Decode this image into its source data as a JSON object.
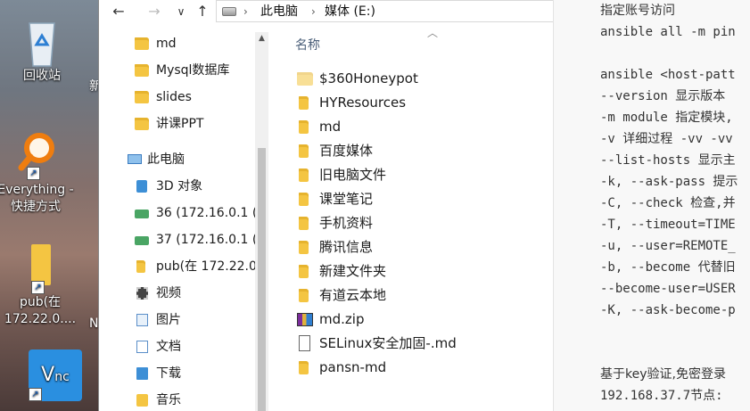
{
  "desktop": {
    "icons": [
      {
        "label": "回收站",
        "icon": "recycle-bin-icon"
      },
      {
        "label": "Everything -\n快捷方式",
        "icon": "everything-magnifier-icon"
      },
      {
        "label": "pub(在\n172.22.0....",
        "icon": "folder-shortcut-icon"
      },
      {
        "label": "",
        "icon": "vnc-icon"
      }
    ],
    "clipped_labels": [
      "新",
      "N"
    ]
  },
  "explorer": {
    "nav_back": "←",
    "nav_forward": "→",
    "nav_recent": "∨",
    "nav_up": "↑",
    "breadcrumb": [
      "此电脑",
      "媒体 (E:)"
    ],
    "nav_items": [
      {
        "label": "md",
        "icon": "folder-icon"
      },
      {
        "label": "Mysql数据库",
        "icon": "folder-icon"
      },
      {
        "label": "slides",
        "icon": "folder-icon"
      },
      {
        "label": "讲课PPT",
        "icon": "folder-icon"
      },
      {
        "label": "此电脑",
        "icon": "this-pc-icon"
      },
      {
        "label": "3D 对象",
        "icon": "3d-objects-icon"
      },
      {
        "label": "36 (172.16.0.1 (",
        "icon": "network-drive-icon"
      },
      {
        "label": "37 (172.16.0.1 (",
        "icon": "network-drive-icon"
      },
      {
        "label": "pub(在 172.22.0.",
        "icon": "folder-icon"
      },
      {
        "label": "视频",
        "icon": "video-icon"
      },
      {
        "label": "图片",
        "icon": "pictures-icon"
      },
      {
        "label": "文档",
        "icon": "documents-icon"
      },
      {
        "label": "下载",
        "icon": "downloads-icon"
      },
      {
        "label": "音乐",
        "icon": "music-icon"
      }
    ],
    "column_header": "名称",
    "files": [
      {
        "name": "$360Honeypot",
        "type": "folder"
      },
      {
        "name": "HYResources",
        "type": "folder"
      },
      {
        "name": "md",
        "type": "folder"
      },
      {
        "name": "百度媒体",
        "type": "folder"
      },
      {
        "name": "旧电脑文件",
        "type": "folder"
      },
      {
        "name": "课堂笔记",
        "type": "folder"
      },
      {
        "name": "手机资料",
        "type": "folder"
      },
      {
        "name": "腾讯信息",
        "type": "folder"
      },
      {
        "name": "新建文件夹",
        "type": "folder"
      },
      {
        "name": "有道云本地",
        "type": "folder"
      },
      {
        "name": "md.zip",
        "type": "zip"
      },
      {
        "name": "SELinux安全加固-.md",
        "type": "document"
      },
      {
        "name": "pansn-md",
        "type": "folder"
      }
    ]
  },
  "editor": {
    "lines": [
      "指定账号访问",
      "ansible all -m pin",
      "",
      "ansible <host-patt",
      "--version 显示版本",
      "-m module 指定模块,",
      "-v 详细过程 -vv -vv",
      "--list-hosts 显示主",
      "-k, --ask-pass 提示",
      "-C, --check 检查,并",
      "-T, --timeout=TIME",
      "-u, --user=REMOTE_",
      "-b, --become 代替旧",
      "--become-user=USER",
      "-K, --ask-become-p",
      "",
      "",
      "基于key验证,免密登录",
      "192.168.37.7节点:"
    ]
  },
  "colors": {
    "folder": "#f4c542",
    "header_text": "#4c607a",
    "editor_bg": "#f8f8f8"
  }
}
